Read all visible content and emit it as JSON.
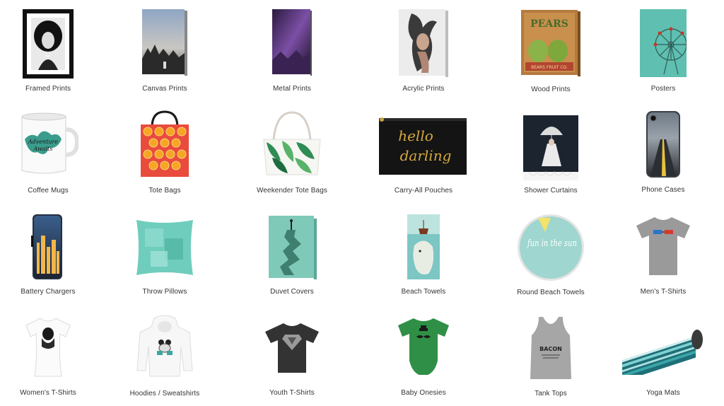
{
  "products": [
    {
      "label": "Framed Prints",
      "icon": "framed-print-thumbnail"
    },
    {
      "label": "Canvas Prints",
      "icon": "canvas-print-thumbnail"
    },
    {
      "label": "Metal Prints",
      "icon": "metal-print-thumbnail"
    },
    {
      "label": "Acrylic Prints",
      "icon": "acrylic-print-thumbnail"
    },
    {
      "label": "Wood Prints",
      "icon": "wood-print-thumbnail"
    },
    {
      "label": "Posters",
      "icon": "poster-thumbnail"
    },
    {
      "label": "Coffee Mugs",
      "icon": "coffee-mug-thumbnail"
    },
    {
      "label": "Tote Bags",
      "icon": "tote-bag-thumbnail"
    },
    {
      "label": "Weekender Tote Bags",
      "icon": "weekender-tote-thumbnail"
    },
    {
      "label": "Carry-All Pouches",
      "icon": "pouch-thumbnail"
    },
    {
      "label": "Shower Curtains",
      "icon": "shower-curtain-thumbnail"
    },
    {
      "label": "Phone Cases",
      "icon": "phone-case-thumbnail"
    },
    {
      "label": "Battery Chargers",
      "icon": "battery-charger-thumbnail"
    },
    {
      "label": "Throw Pillows",
      "icon": "throw-pillow-thumbnail"
    },
    {
      "label": "Duvet Covers",
      "icon": "duvet-cover-thumbnail"
    },
    {
      "label": "Beach Towels",
      "icon": "beach-towel-thumbnail"
    },
    {
      "label": "Round Beach Towels",
      "icon": "round-beach-towel-thumbnail"
    },
    {
      "label": "Men's T-Shirts",
      "icon": "mens-tshirt-thumbnail"
    },
    {
      "label": "Women's T-Shirts",
      "icon": "womens-tshirt-thumbnail"
    },
    {
      "label": "Hoodies / Sweatshirts",
      "icon": "hoodie-thumbnail"
    },
    {
      "label": "Youth T-Shirts",
      "icon": "youth-tshirt-thumbnail"
    },
    {
      "label": "Baby Onesies",
      "icon": "baby-onesie-thumbnail"
    },
    {
      "label": "Tank Tops",
      "icon": "tank-top-thumbnail"
    },
    {
      "label": "Yoga Mats",
      "icon": "yoga-mat-thumbnail"
    }
  ],
  "art_text": {
    "wood_title": "PEARS",
    "wood_sub": "BEARS FRUIT CO.",
    "pouch_line1": "hello",
    "pouch_line2": "darling",
    "round_towel_text": "fun in the sun",
    "tank_text": "BACON"
  },
  "colors": {
    "teal": "#5fbfb0",
    "dark": "#1a1a1a",
    "label": "#333333"
  }
}
